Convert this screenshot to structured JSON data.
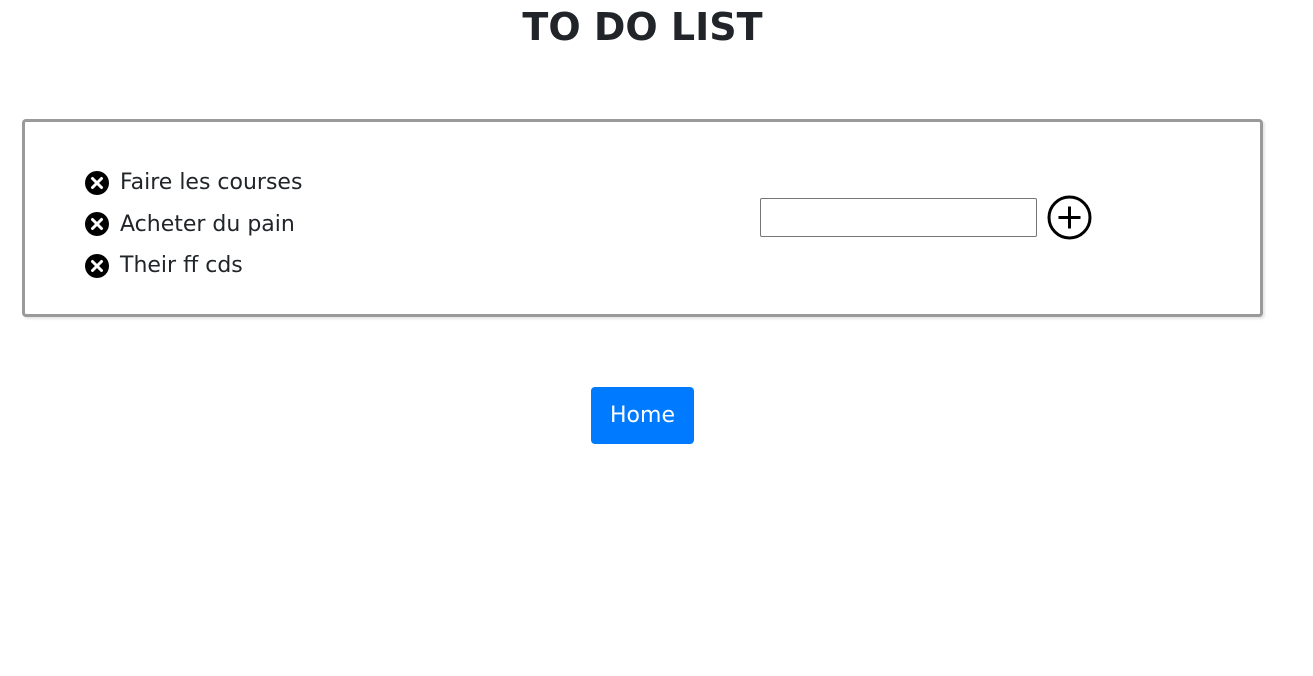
{
  "header": {
    "title": "TO DO LIST"
  },
  "todo": {
    "items": [
      {
        "label": "Faire les courses",
        "remove_icon": "circle-x-icon"
      },
      {
        "label": "Acheter du pain",
        "remove_icon": "circle-x-icon"
      },
      {
        "label": "Their ff cds",
        "remove_icon": "circle-x-icon"
      }
    ],
    "input": {
      "value": "",
      "placeholder": ""
    },
    "add_icon": "circle-plus-icon"
  },
  "nav": {
    "home_label": "Home"
  },
  "colors": {
    "primary": "#007bff",
    "text": "#212529",
    "card_border": "#9a9a9a"
  }
}
